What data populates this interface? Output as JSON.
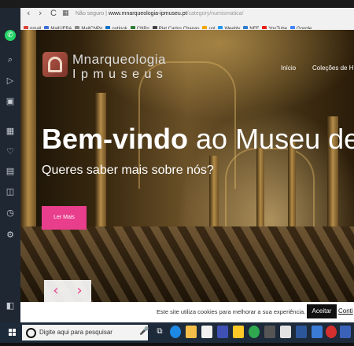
{
  "browser": {
    "back_glyph": "‹",
    "forward_glyph": "›",
    "reload_glyph": "C",
    "speed_dial_glyph": "▦",
    "security_label": "Não seguro",
    "url_host": "www.mnarqueologia-ipmuseu.pt",
    "url_path": "/category/numismatica/"
  },
  "bookmarks": [
    {
      "label": "gmail",
      "color": "#db4437"
    },
    {
      "label": "MailUFBA",
      "color": "#3c6fd8"
    },
    {
      "label": "MailCNPq",
      "color": "#888888"
    },
    {
      "label": "outlook",
      "color": "#0072c6"
    },
    {
      "label": "CNPq",
      "color": "#2e7d32"
    },
    {
      "label": "Plat Carlos Chagas",
      "color": "#444444"
    },
    {
      "label": "uol",
      "color": "#f7a600"
    },
    {
      "label": "Weebly",
      "color": "#2196f3"
    },
    {
      "label": "NFE",
      "color": "#2e7dd1"
    },
    {
      "label": "YouTube",
      "color": "#e62117"
    },
    {
      "label": "Google",
      "color": "#4285f4"
    }
  ],
  "site": {
    "logo_line1": "Mnarqueologia",
    "logo_line2": "Ipmuseus",
    "nav": [
      "Início",
      "Coleções de His"
    ],
    "headline_bold": "Bem-vindo",
    "headline_rest": " ao Museu de Arque",
    "subhead": "Queres saber mais sobre nós?",
    "cta": "Ler Mais",
    "prev_glyph": "‹",
    "next_glyph": "›"
  },
  "cookie": {
    "text": "Este site utiliza cookies para melhorar a sua experiência.",
    "accept": "Aceitar",
    "continue": "Conti"
  },
  "taskbar": {
    "search_placeholder": "Digite aqui para pesquisar",
    "mic_glyph": "🎤",
    "apps": [
      "task-view",
      "edge",
      "file-explorer",
      "store",
      "media",
      "folder",
      "chrome",
      "calculator",
      "mail",
      "word",
      "word-2",
      "opera",
      "opera-2"
    ],
    "accent": "#e83e8c"
  },
  "sidebar": {
    "icons": [
      "whatsapp-icon",
      "search-icon",
      "send-icon",
      "camera-icon",
      "apps-icon",
      "heart-icon",
      "news-icon",
      "chat-icon",
      "history-icon",
      "settings-icon",
      "sidebar-toggle-icon"
    ]
  }
}
